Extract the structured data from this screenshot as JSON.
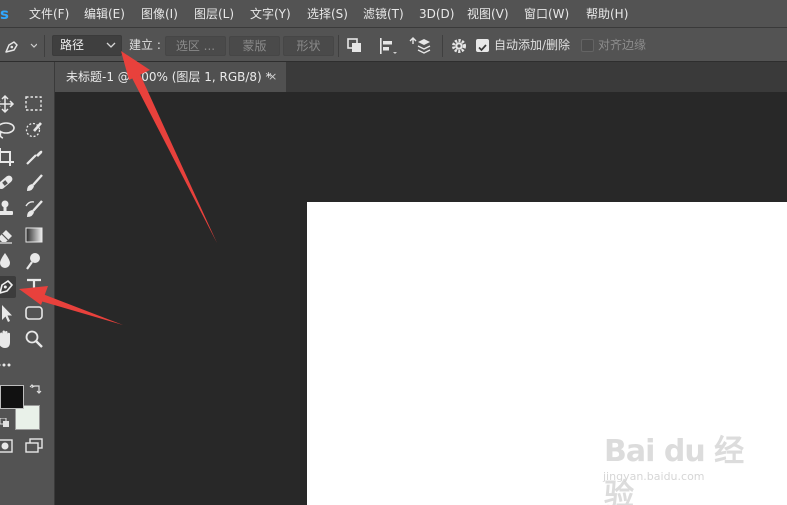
{
  "menu": {
    "logo": "s",
    "items": [
      "文件(F)",
      "编辑(E)",
      "图像(I)",
      "图层(L)",
      "文字(Y)",
      "选择(S)",
      "滤镜(T)",
      "3D(D)",
      "视图(V)",
      "窗口(W)",
      "帮助(H)"
    ]
  },
  "options": {
    "mode_value": "路径",
    "make_label": "建立 :",
    "selection_button": "选区 ...",
    "mask_button": "蒙版",
    "shape_button": "形状",
    "auto_add_delete_label": "自动添加/删除",
    "auto_add_delete_checked": true,
    "align_edges_label": "对齐边缘",
    "align_edges_checked": false
  },
  "document": {
    "tab_title": "未标题-1 @ 100% (图层 1, RGB/8) *",
    "close_symbol": "×"
  },
  "toolbar": {
    "active_tool": "pen-tool",
    "foreground_color": "#111111",
    "background_color": "#e9f1e9",
    "tools": [
      {
        "name": "move-tool"
      },
      {
        "name": "rect-marquee-tool"
      },
      {
        "name": "lasso-tool"
      },
      {
        "name": "quick-selection-tool"
      },
      {
        "name": "crop-tool"
      },
      {
        "name": "eyedropper-tool"
      },
      {
        "name": "healing-brush-tool"
      },
      {
        "name": "brush-tool"
      },
      {
        "name": "clone-stamp-tool"
      },
      {
        "name": "history-brush-tool"
      },
      {
        "name": "eraser-tool"
      },
      {
        "name": "gradient-tool"
      },
      {
        "name": "blur-tool"
      },
      {
        "name": "dodge-tool"
      },
      {
        "name": "pen-tool"
      },
      {
        "name": "type-tool"
      },
      {
        "name": "path-selection-tool"
      },
      {
        "name": "rectangle-tool"
      },
      {
        "name": "hand-tool"
      },
      {
        "name": "zoom-tool"
      },
      {
        "name": "edit-toolbar"
      }
    ]
  },
  "colors": {
    "accent": "#31a8ff",
    "annotation_arrow": "#e8413c",
    "canvas": "#ffffff"
  },
  "watermark": {
    "main": "Bai du 经验",
    "sub": "jingyan.baidu.com"
  }
}
